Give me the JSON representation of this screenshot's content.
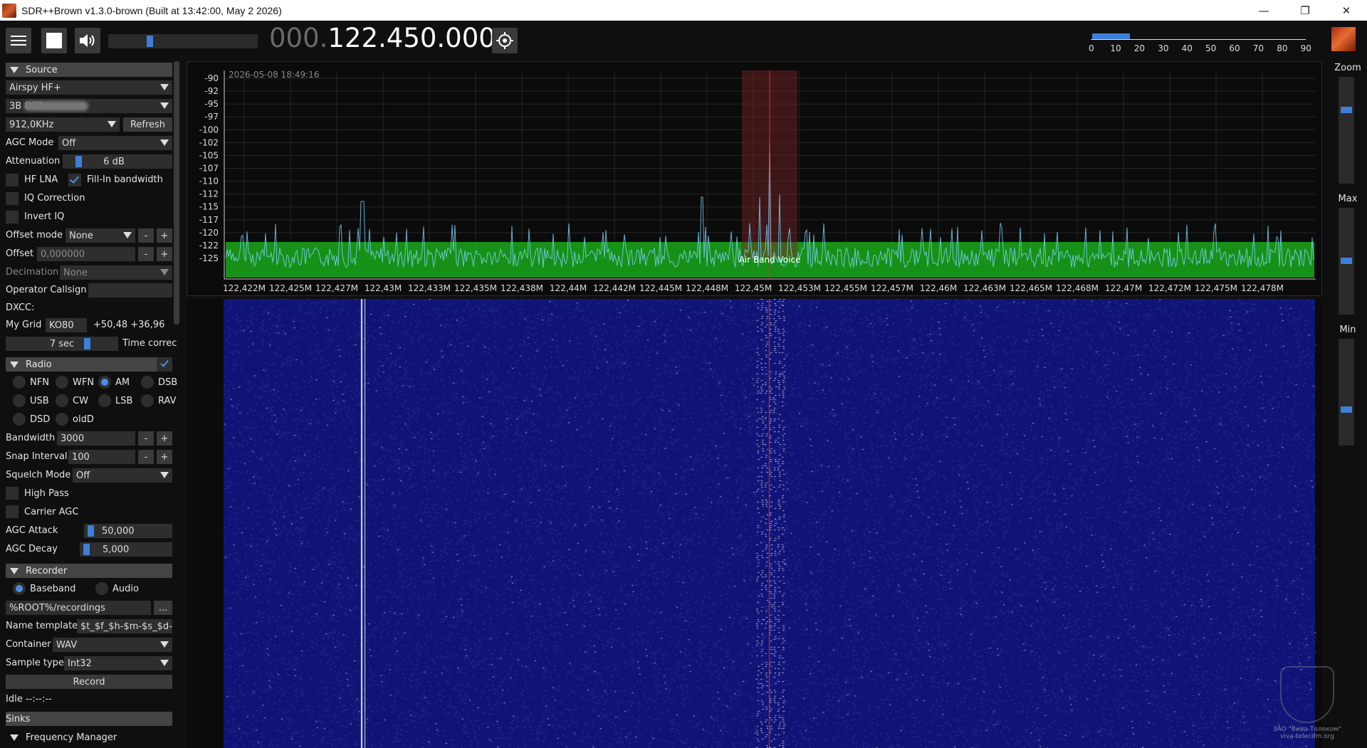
{
  "window": {
    "title": "SDR++Brown v1.3.0-brown (Built at 13:42:00, May  2 2026)",
    "minimize": "—",
    "restore": "❐",
    "close": "✕"
  },
  "toolbar": {
    "frequency_dim": "000.",
    "frequency_lit": "122.450.000",
    "volume_level": 0.27,
    "snr_scale": [
      "0",
      "10",
      "20",
      "30",
      "40",
      "50",
      "60",
      "70",
      "80",
      "90"
    ],
    "snr_level": 16
  },
  "source": {
    "header": "Source",
    "device": "Airspy HF+",
    "serial": "3B            8C7",
    "samplerate": "912,0KHz",
    "refresh": "Refresh",
    "agc_mode_label": "AGC Mode",
    "agc_mode": "Off",
    "attenuation_label": "Attenuation",
    "attenuation": "6 dB",
    "hf_lna": "HF LNA",
    "fill_in": "Fill-In bandwidth",
    "iq_correction": "IQ Correction",
    "invert_iq": "Invert IQ",
    "offset_mode_label": "Offset mode",
    "offset_mode": "None",
    "offset_label": "Offset",
    "offset": "0,000000",
    "decimation_label": "Decimation",
    "decimation": "None",
    "callsign_label": "Operator Callsign",
    "dxcc_label": "DXCC:",
    "grid_label": "My Grid",
    "grid": "KO80",
    "grid_coords": "+50,48 +36,96",
    "time_value": "7 sec",
    "time_label": "Time correc",
    "minus": "-",
    "plus": "+"
  },
  "radio": {
    "header": "Radio",
    "modes": [
      "NFM",
      "WFM",
      "AM",
      "DSB",
      "USB",
      "CW",
      "LSB",
      "RAW",
      "DSD",
      "oldDSD"
    ],
    "mode_labels": [
      "NFN",
      "WFN",
      "AM",
      "DSB",
      "USB",
      "CW",
      "LSB",
      "RAV",
      "DSD",
      "oldD"
    ],
    "selected_mode": "AM",
    "bandwidth_label": "Bandwidth",
    "bandwidth": "3000",
    "snap_label": "Snap Interval",
    "snap": "100",
    "squelch_label": "Squelch Mode",
    "squelch": "Off",
    "high_pass": "High Pass",
    "carrier_agc": "Carrier AGC",
    "agc_attack_label": "AGC Attack",
    "agc_attack": "50,000",
    "agc_decay_label": "AGC Decay",
    "agc_decay": "5,000"
  },
  "recorder": {
    "header": "Recorder",
    "baseband": "Baseband",
    "audio": "Audio",
    "path": "%ROOT%/recordings",
    "browse": "...",
    "name_template_label": "Name template",
    "name_template": "$t_$f_$h-$m-$s_$d-$",
    "container_label": "Container",
    "container": "WAV",
    "sample_type_label": "Sample type",
    "sample_type": "Int32",
    "record": "Record",
    "status": "Idle --:--:--"
  },
  "sinks": {
    "header": "Sinks"
  },
  "freq_manager": {
    "header": "Frequency Manager"
  },
  "right_panel": {
    "zoom": "Zoom",
    "zoom_level": 0.3,
    "max": "Max",
    "max_level": 0.5,
    "min": "Min",
    "min_level": 0.68
  },
  "spectrum": {
    "timestamp": "2026-05-08 18:49:16",
    "db_labels": [
      "-90",
      "-92",
      "-95",
      "-97",
      "-100",
      "-102",
      "-105",
      "-107",
      "-110",
      "-112",
      "-115",
      "-117",
      "-120",
      "-122",
      "-125"
    ],
    "freq_labels": [
      "122,422M",
      "122,425M",
      "122,427M",
      "122,43M",
      "122,433M",
      "122,435M",
      "122,438M",
      "122,44M",
      "122,442M",
      "122,445M",
      "122,448M",
      "122,45M",
      "122,453M",
      "122,455M",
      "122,457M",
      "122,46M",
      "122,463M",
      "122,465M",
      "122,468M",
      "122,47M",
      "122,472M",
      "122,475M",
      "122,478M"
    ],
    "band_label": "Air Band Voice",
    "colors": {
      "band": "#1aa81a",
      "trace": "#7fd6ff",
      "vfo": "#ff2020",
      "waterfall": "#101476"
    }
  },
  "watermark": {
    "line1": "ЗАО \"Вива-Телеком\"",
    "line2": "viva-telecom.org"
  }
}
